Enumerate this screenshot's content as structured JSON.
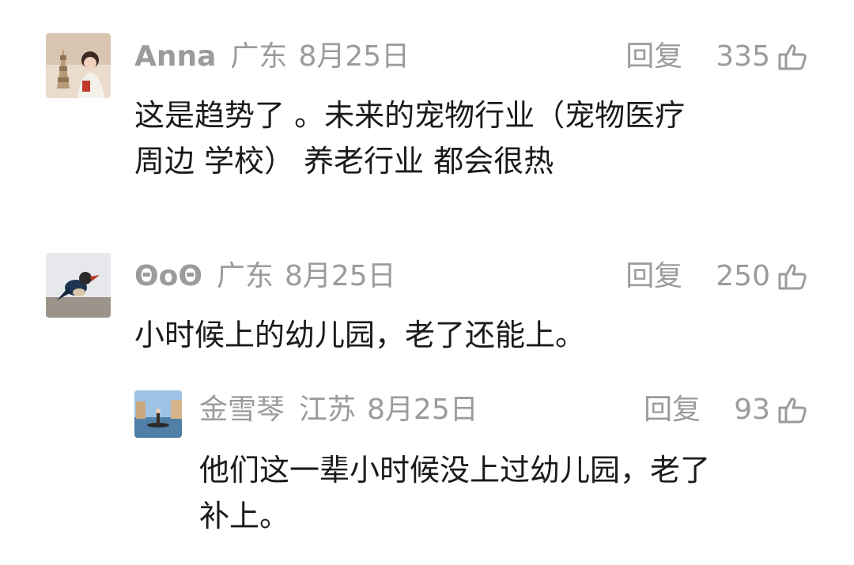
{
  "comments": [
    {
      "name": "Anna",
      "location": "广东",
      "date": "8月25日",
      "reply_label": "回复",
      "likes": "335",
      "text": "这是趋势了 。未来的宠物行业（宠物医疗\n周边 学校） 养老行业  都会很热",
      "avatar_icon": "user-avatar-photo"
    },
    {
      "name": "ΘοΘ",
      "location": "广东",
      "date": "8月25日",
      "reply_label": "回复",
      "likes": "250",
      "text": "小时候上的幼儿园，老了还能上。",
      "avatar_icon": "bird-avatar-photo"
    },
    {
      "name": "金雪琴",
      "location": "江苏",
      "date": "8月25日",
      "reply_label": "回复",
      "likes": "93",
      "text": "他们这一辈小时候没上过幼儿园，老了\n补上。",
      "avatar_icon": "canal-avatar-photo"
    }
  ],
  "colors": {
    "meta": "#9b9b9b",
    "text": "#1a1a1a",
    "background": "#ffffff"
  }
}
